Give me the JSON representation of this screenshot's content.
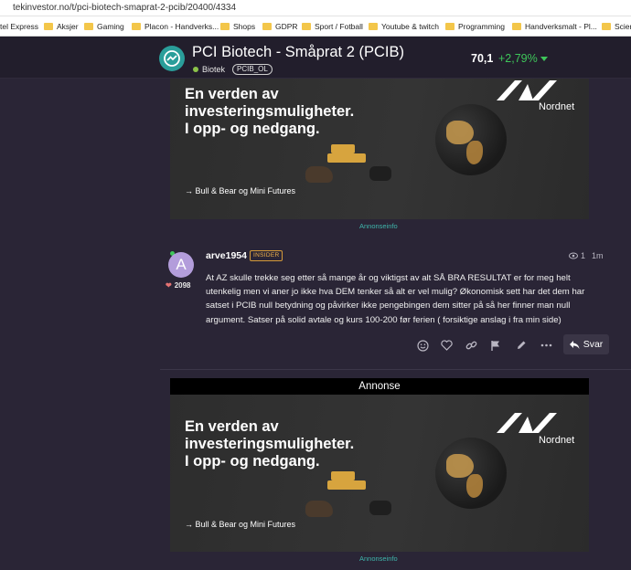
{
  "browser": {
    "url": "tekinvestor.no/t/pci-biotech-smaprat-2-pcib/20400/4334",
    "bookmarks": [
      "tel Express",
      "Aksjer",
      "Gaming",
      "Placon - Handverks...",
      "Shops",
      "GDPR",
      "Sport / Fotball",
      "Youtube & twitch",
      "Programming",
      "Handverksmalt - Pl...",
      "Scienc"
    ]
  },
  "header": {
    "title": "PCI Biotech - Småprat 2 (PCIB)",
    "category": "Biotek",
    "tag": "PCIB_OL",
    "price": "70,1",
    "change": "+2,79%",
    "change_color": "#3ec65a"
  },
  "ads": [
    {
      "headline": [
        "En verden av",
        "investeringsmuligheter.",
        "I opp- og nedgang."
      ],
      "link": "→ Bull & Bear og Mini Futures",
      "brand": "Nordnet",
      "info": "Annonseinfo"
    },
    {
      "label": "Annonse",
      "headline": [
        "En verden av",
        "investeringsmuligheter.",
        "I opp- og nedgang."
      ],
      "link": "→ Bull & Bear og Mini Futures",
      "brand": "Nordnet",
      "info": "Annonseinfo"
    }
  ],
  "post": {
    "avatar_letter": "A",
    "username": "arve1954",
    "badge": "INSIDER",
    "likes": "2098",
    "views": "1",
    "time": "1m",
    "text": "At AZ skulle trekke seg etter så mange år og viktigst av alt SÅ BRA RESULTAT er for meg helt utenkelig men vi aner jo ikke hva DEM tenker så alt er vel mulig? Økonomisk sett har det dem har satset i PCIB null betydning og påvirker ikke pengebingen dem sitter på så her finner man null argument. Satser på solid avtale og kurs 100-200 før ferien ( forsiktige anslag i fra min side)",
    "actions": [
      "smiley-icon",
      "heart-icon",
      "link-icon",
      "flag-icon",
      "pencil-icon",
      "more-icon"
    ],
    "reply_label": "Svar"
  }
}
